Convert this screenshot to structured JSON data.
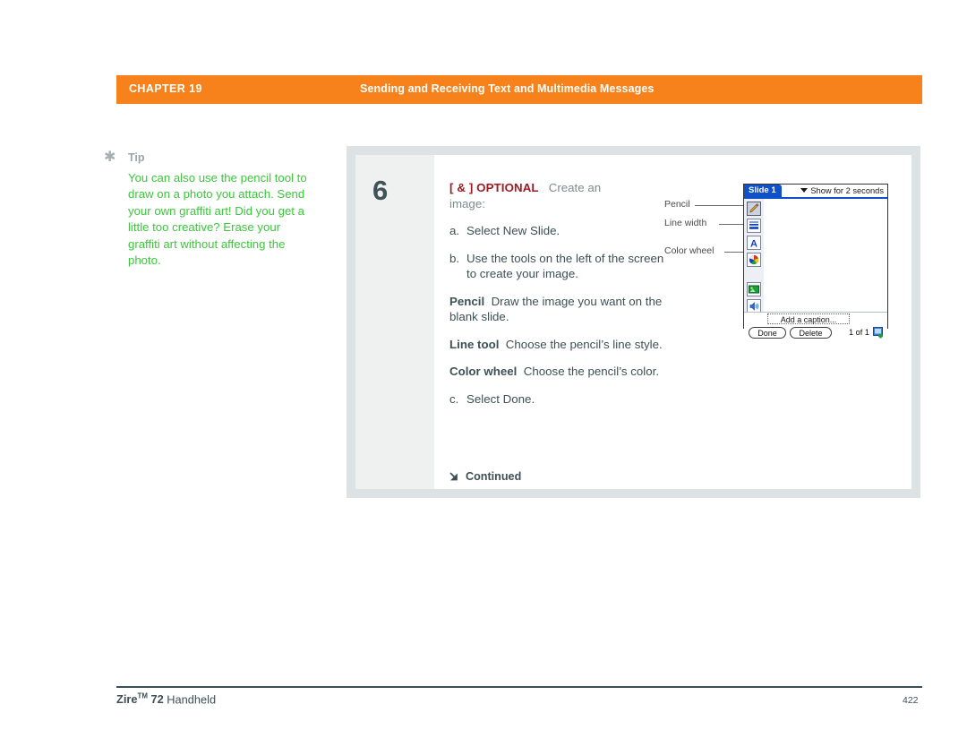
{
  "header": {
    "chapter_label": "CHAPTER 19",
    "chapter_title": "Sending and Receiving Text and Multimedia Messages",
    "bar_color": "#F7821B"
  },
  "tip": {
    "icon": "asterisk-icon",
    "title": "Tip",
    "body": "You can also use the pencil tool to draw on a photo you attach. Send your own graffiti art! Did you get a little too creative? Erase your graffiti art without affecting the photo.",
    "text_color": "#3CC63C"
  },
  "step": {
    "number": "6",
    "optional_tag": "[ & ] OPTIONAL",
    "optional_rest": "Create an",
    "optional_second_line": "image:",
    "items": [
      {
        "letter": "a.",
        "text": "Select New Slide."
      },
      {
        "letter": "b.",
        "text": "Use the tools on the left of the screen to create your image."
      }
    ],
    "definitions": [
      {
        "term": "Pencil",
        "desc": "Draw the image you want on the blank slide."
      },
      {
        "term": "Line tool",
        "desc": "Choose the pencil’s line style."
      },
      {
        "term": "Color wheel",
        "desc": "Choose the pencil’s color."
      }
    ],
    "final_item": {
      "letter": "c.",
      "text": "Select Done."
    },
    "continued_label": "Continued",
    "optional_tag_color": "#9E1B20"
  },
  "device": {
    "callouts": [
      {
        "label": "Pencil"
      },
      {
        "label": "Line width"
      },
      {
        "label": "Color wheel"
      }
    ],
    "slide_tab": "Slide 1",
    "duration": "Show for 2 seconds",
    "tools": [
      {
        "name": "pencil-tool",
        "selected": true
      },
      {
        "name": "line-width-tool",
        "selected": false
      },
      {
        "name": "text-tool",
        "selected": false
      },
      {
        "name": "color-wheel-tool",
        "selected": false
      },
      {
        "name": "image-tool",
        "selected": false
      },
      {
        "name": "sound-tool",
        "selected": false
      }
    ],
    "caption_placeholder": "Add a caption...",
    "done_button": "Done",
    "delete_button": "Delete",
    "page_count": "1 of 1",
    "accent_color": "#1050C8"
  },
  "footer": {
    "product_bold": "Zire",
    "product_tm": "TM",
    "product_model": " 72",
    "product_rest": " Handheld",
    "page_number": "422"
  }
}
